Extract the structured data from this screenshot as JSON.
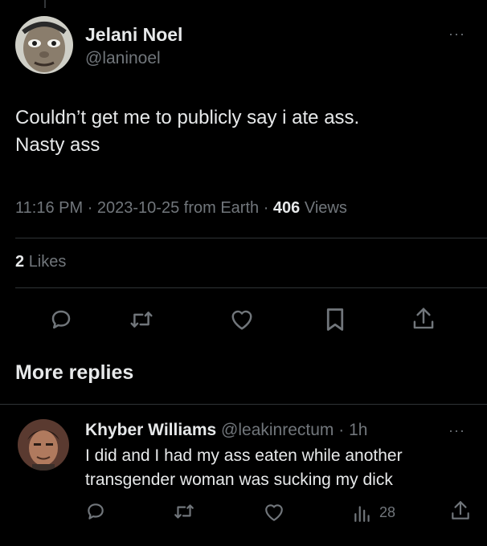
{
  "tweet": {
    "author_name": "Jelani Noel",
    "author_handle": "@laninoel",
    "text_line1": "Couldn’t get me to publicly say i ate ass.",
    "text_line2": "Nasty ass",
    "time": "11:16 PM",
    "date": "2023-10-25",
    "source": "from Earth",
    "views_count": "406",
    "views_label": "Views",
    "likes_count": "2",
    "likes_label": "Likes",
    "more_glyph": "···"
  },
  "section": {
    "more_replies": "More replies"
  },
  "reply": {
    "author_name": "Khyber Williams",
    "author_handle": "@leakinrectum",
    "age": "1h",
    "text": "I did and I had my ass eaten while another transgender woman was sucking my dick",
    "views": "28",
    "more_glyph": "···"
  },
  "icons": [
    "reply-icon",
    "retweet-icon",
    "like-icon",
    "bookmark-icon",
    "share-icon",
    "views-icon"
  ],
  "colors": {
    "background": "#000000",
    "text": "#e7e9ea",
    "secondary": "#71767b",
    "divider": "#2f3336"
  }
}
